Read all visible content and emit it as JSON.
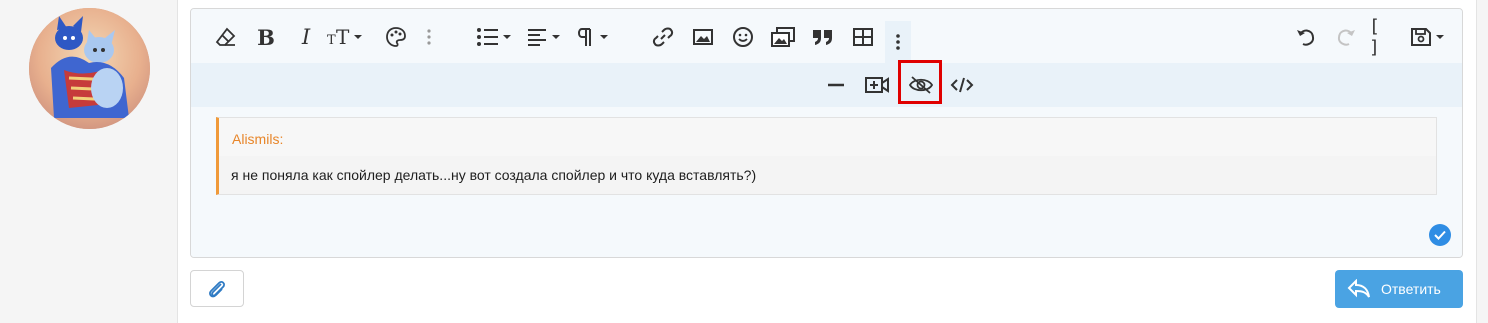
{
  "post": {
    "avatar_alt": "avatar"
  },
  "toolbar": {
    "main": [
      {
        "name": "remove-format-icon"
      },
      {
        "name": "bold-icon",
        "glyph": "B"
      },
      {
        "name": "italic-icon",
        "glyph": "I"
      },
      {
        "name": "font-size-icon"
      },
      {
        "name": "text-color-icon"
      },
      {
        "name": "more-text-icon"
      },
      {
        "name": "list-icon"
      },
      {
        "name": "align-icon"
      },
      {
        "name": "paragraph-format-icon"
      },
      {
        "name": "insert-link-icon"
      },
      {
        "name": "insert-image-icon"
      },
      {
        "name": "smilie-icon"
      },
      {
        "name": "media-gallery-icon"
      },
      {
        "name": "quote-icon"
      },
      {
        "name": "table-icon"
      },
      {
        "name": "more-rich-icon"
      },
      {
        "name": "undo-icon"
      },
      {
        "name": "redo-icon"
      },
      {
        "name": "toggle-bbcode-icon",
        "glyph": "[ ]"
      },
      {
        "name": "drafts-icon"
      }
    ],
    "more": [
      {
        "name": "horizontal-line-icon"
      },
      {
        "name": "insert-video-icon"
      },
      {
        "name": "spoiler-icon",
        "highlighted": true
      },
      {
        "name": "code-icon"
      }
    ]
  },
  "quote": {
    "author": "Alismils:",
    "text": "я не поняла как спойлер делать...ну вот создала спойлер и что куда вставлять?)"
  },
  "actions": {
    "attach_icon": "paperclip-icon",
    "reply_label": "Ответить"
  },
  "colors": {
    "accent": "#4aa3e3",
    "quote_border": "#f09a3a",
    "quote_author": "#e8862a",
    "highlight": "#e00000"
  }
}
